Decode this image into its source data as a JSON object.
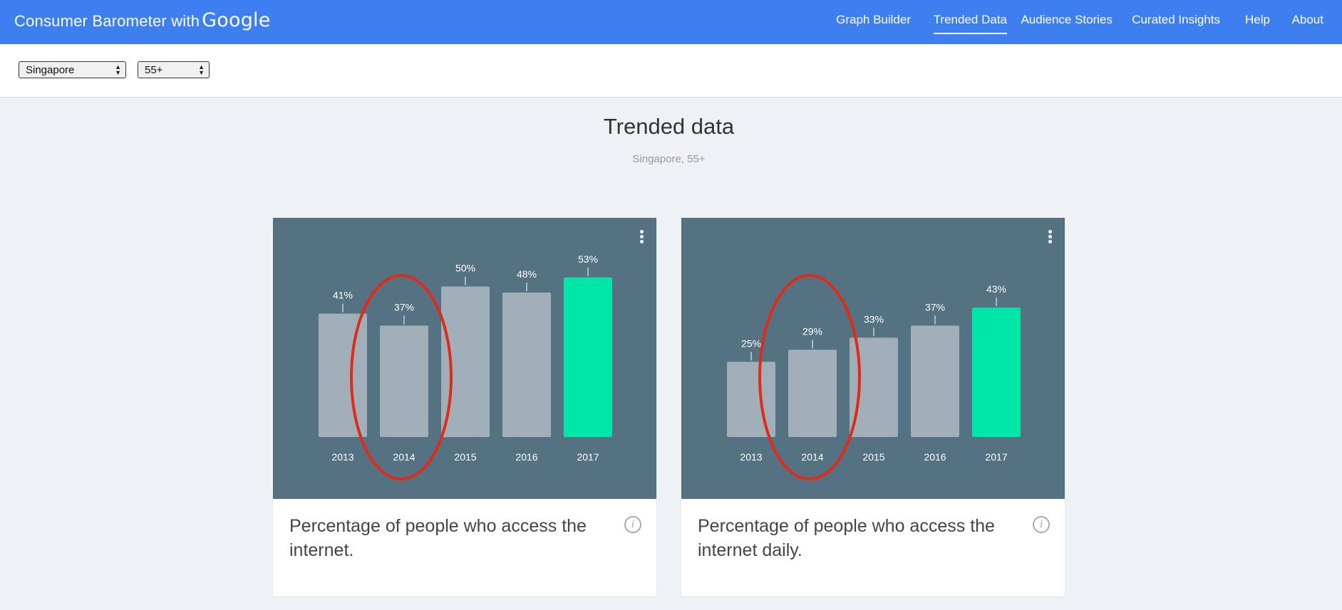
{
  "header": {
    "brand": "Consumer Barometer with",
    "brand_logo": "Google",
    "nav": [
      {
        "label": "Graph Builder",
        "active": false
      },
      {
        "label": "Trended Data",
        "active": true
      },
      {
        "label": "Audience Stories",
        "active": false
      },
      {
        "label": "Curated Insights",
        "active": false
      },
      {
        "label": "Help",
        "active": false
      },
      {
        "label": "About",
        "active": false
      }
    ]
  },
  "filters": {
    "country": "Singapore",
    "age": "55+"
  },
  "page": {
    "title": "Trended data",
    "subtitle": "Singapore, 55+"
  },
  "colors": {
    "header": "#3e7ff0",
    "plot_bg": "#557282",
    "bar": "#a1b0b8",
    "bar_highlight": "#00e5a8",
    "annotation": "#e02a1a"
  },
  "chart_data": [
    {
      "type": "bar",
      "categories": [
        "2013",
        "2014",
        "2015",
        "2016",
        "2017"
      ],
      "values": [
        41,
        37,
        50,
        48,
        53
      ],
      "labels": [
        "41%",
        "37%",
        "50%",
        "48%",
        "53%"
      ],
      "highlight_index": 4,
      "annotated_index": 1,
      "caption": "Percentage of people who access the internet."
    },
    {
      "type": "bar",
      "categories": [
        "2013",
        "2014",
        "2015",
        "2016",
        "2017"
      ],
      "values": [
        25,
        29,
        33,
        37,
        43
      ],
      "labels": [
        "25%",
        "29%",
        "33%",
        "37%",
        "43%"
      ],
      "highlight_index": 4,
      "annotated_index": 1,
      "caption": "Percentage of people who access the internet daily."
    }
  ]
}
